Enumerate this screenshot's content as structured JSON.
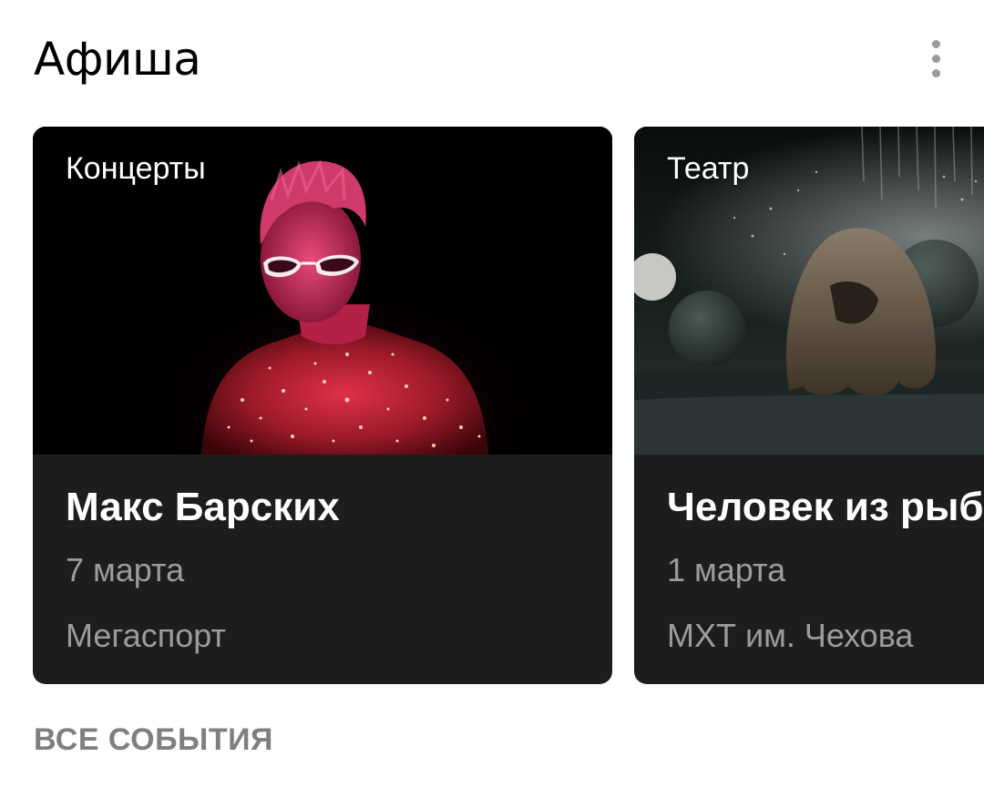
{
  "header": {
    "title": "Афиша",
    "menu_icon": "more-vertical-icon"
  },
  "cards": [
    {
      "category": "Концерты",
      "name": "Макс Барских",
      "date": "7 марта",
      "venue": "Мегаспорт",
      "image": "concert-performer-photo"
    },
    {
      "category": "Театр",
      "name": "Человек из рыб",
      "date": "1 марта",
      "venue": "МХТ им. Чехова",
      "image": "theatre-scene-photo"
    }
  ],
  "footer": {
    "all_events_label": "ВСЕ СОБЫТИЯ"
  },
  "colors": {
    "card_background": "#1d1d1d",
    "secondary_text": "#9c9c9c",
    "link_text": "#7f7f7f"
  }
}
